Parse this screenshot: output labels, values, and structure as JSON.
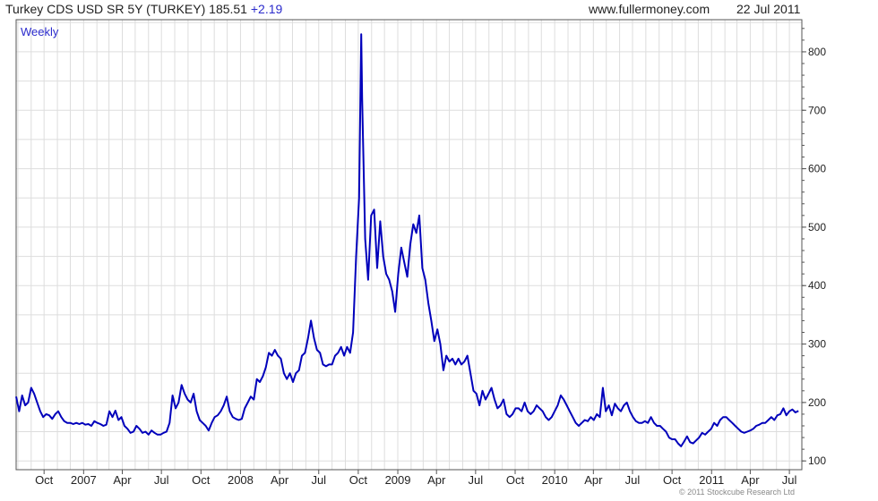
{
  "header": {
    "title": "Turkey CDS USD SR 5Y (TURKEY) 185.51",
    "change": "+2.19",
    "site": "www.fullermoney.com",
    "date": "22 Jul 2011"
  },
  "footer": {
    "copyright": "© 2011 Stockcube Research Ltd"
  },
  "colors": {
    "line": "#0000bb",
    "grid": "#dddddd",
    "frame": "#555555",
    "label": "#2b2bcc"
  },
  "chart_data": {
    "type": "line",
    "frequency_label": "Weekly",
    "x_tick_labels": [
      "Oct",
      "2007",
      "Apr",
      "Jul",
      "Oct",
      "2008",
      "Apr",
      "Jul",
      "Oct",
      "2009",
      "Apr",
      "Jul",
      "Oct",
      "2010",
      "Apr",
      "Jul",
      "Oct",
      "2011",
      "Apr",
      "Jul"
    ],
    "x_tick_dates": [
      "2006-10-01",
      "2007-01-01",
      "2007-04-01",
      "2007-07-01",
      "2007-10-01",
      "2008-01-01",
      "2008-04-01",
      "2008-07-01",
      "2008-10-01",
      "2009-01-01",
      "2009-04-01",
      "2009-07-01",
      "2009-10-01",
      "2010-01-01",
      "2010-04-01",
      "2010-07-01",
      "2010-10-01",
      "2011-01-01",
      "2011-04-01",
      "2011-07-01"
    ],
    "y_ticks": [
      100,
      200,
      300,
      400,
      500,
      600,
      700,
      800
    ],
    "ylim": [
      85,
      855
    ],
    "xlim": [
      "2006-07-28",
      "2011-07-30"
    ],
    "y_axis_position": "right",
    "grid": true,
    "series": [
      {
        "values": [
          [
            "2006-07-28",
            210
          ],
          [
            "2006-08-04",
            185
          ],
          [
            "2006-08-11",
            212
          ],
          [
            "2006-08-18",
            195
          ],
          [
            "2006-08-25",
            200
          ],
          [
            "2006-09-01",
            225
          ],
          [
            "2006-09-08",
            215
          ],
          [
            "2006-09-15",
            200
          ],
          [
            "2006-09-22",
            185
          ],
          [
            "2006-09-29",
            175
          ],
          [
            "2006-10-06",
            180
          ],
          [
            "2006-10-13",
            178
          ],
          [
            "2006-10-20",
            172
          ],
          [
            "2006-10-27",
            180
          ],
          [
            "2006-11-03",
            185
          ],
          [
            "2006-11-10",
            175
          ],
          [
            "2006-11-17",
            168
          ],
          [
            "2006-11-24",
            165
          ],
          [
            "2006-12-01",
            165
          ],
          [
            "2006-12-08",
            163
          ],
          [
            "2006-12-15",
            165
          ],
          [
            "2006-12-22",
            163
          ],
          [
            "2006-12-29",
            165
          ],
          [
            "2007-01-05",
            162
          ],
          [
            "2007-01-12",
            163
          ],
          [
            "2007-01-19",
            160
          ],
          [
            "2007-01-26",
            168
          ],
          [
            "2007-02-02",
            165
          ],
          [
            "2007-02-09",
            163
          ],
          [
            "2007-02-16",
            160
          ],
          [
            "2007-02-23",
            162
          ],
          [
            "2007-03-02",
            185
          ],
          [
            "2007-03-09",
            175
          ],
          [
            "2007-03-16",
            186
          ],
          [
            "2007-03-23",
            170
          ],
          [
            "2007-03-30",
            175
          ],
          [
            "2007-04-06",
            160
          ],
          [
            "2007-04-13",
            155
          ],
          [
            "2007-04-20",
            148
          ],
          [
            "2007-04-27",
            150
          ],
          [
            "2007-05-04",
            160
          ],
          [
            "2007-05-11",
            155
          ],
          [
            "2007-05-18",
            148
          ],
          [
            "2007-05-25",
            150
          ],
          [
            "2007-06-01",
            145
          ],
          [
            "2007-06-08",
            152
          ],
          [
            "2007-06-15",
            148
          ],
          [
            "2007-06-22",
            145
          ],
          [
            "2007-06-29",
            145
          ],
          [
            "2007-07-06",
            148
          ],
          [
            "2007-07-13",
            150
          ],
          [
            "2007-07-20",
            165
          ],
          [
            "2007-07-27",
            212
          ],
          [
            "2007-08-03",
            190
          ],
          [
            "2007-08-10",
            200
          ],
          [
            "2007-08-17",
            230
          ],
          [
            "2007-08-24",
            215
          ],
          [
            "2007-08-31",
            205
          ],
          [
            "2007-09-07",
            200
          ],
          [
            "2007-09-14",
            215
          ],
          [
            "2007-09-21",
            185
          ],
          [
            "2007-09-28",
            170
          ],
          [
            "2007-10-05",
            165
          ],
          [
            "2007-10-12",
            160
          ],
          [
            "2007-10-19",
            152
          ],
          [
            "2007-10-26",
            165
          ],
          [
            "2007-11-02",
            175
          ],
          [
            "2007-11-09",
            178
          ],
          [
            "2007-11-16",
            185
          ],
          [
            "2007-11-23",
            195
          ],
          [
            "2007-11-30",
            210
          ],
          [
            "2007-12-07",
            185
          ],
          [
            "2007-12-14",
            175
          ],
          [
            "2007-12-21",
            172
          ],
          [
            "2007-12-28",
            170
          ],
          [
            "2008-01-04",
            172
          ],
          [
            "2008-01-11",
            190
          ],
          [
            "2008-01-18",
            200
          ],
          [
            "2008-01-25",
            210
          ],
          [
            "2008-02-01",
            205
          ],
          [
            "2008-02-08",
            240
          ],
          [
            "2008-02-15",
            235
          ],
          [
            "2008-02-22",
            245
          ],
          [
            "2008-02-29",
            260
          ],
          [
            "2008-03-07",
            285
          ],
          [
            "2008-03-14",
            280
          ],
          [
            "2008-03-21",
            290
          ],
          [
            "2008-03-28",
            280
          ],
          [
            "2008-04-04",
            275
          ],
          [
            "2008-04-11",
            250
          ],
          [
            "2008-04-18",
            240
          ],
          [
            "2008-04-25",
            250
          ],
          [
            "2008-05-02",
            235
          ],
          [
            "2008-05-09",
            250
          ],
          [
            "2008-05-16",
            255
          ],
          [
            "2008-05-23",
            280
          ],
          [
            "2008-05-30",
            285
          ],
          [
            "2008-06-06",
            310
          ],
          [
            "2008-06-13",
            340
          ],
          [
            "2008-06-20",
            310
          ],
          [
            "2008-06-27",
            290
          ],
          [
            "2008-07-04",
            285
          ],
          [
            "2008-07-11",
            265
          ],
          [
            "2008-07-18",
            262
          ],
          [
            "2008-07-25",
            265
          ],
          [
            "2008-08-01",
            265
          ],
          [
            "2008-08-08",
            280
          ],
          [
            "2008-08-15",
            285
          ],
          [
            "2008-08-22",
            295
          ],
          [
            "2008-08-29",
            280
          ],
          [
            "2008-09-05",
            295
          ],
          [
            "2008-09-12",
            285
          ],
          [
            "2008-09-19",
            320
          ],
          [
            "2008-09-26",
            450
          ],
          [
            "2008-10-03",
            550
          ],
          [
            "2008-10-08",
            830
          ],
          [
            "2008-10-10",
            720
          ],
          [
            "2008-10-17",
            480
          ],
          [
            "2008-10-24",
            410
          ],
          [
            "2008-10-31",
            520
          ],
          [
            "2008-11-07",
            530
          ],
          [
            "2008-11-14",
            430
          ],
          [
            "2008-11-21",
            510
          ],
          [
            "2008-11-28",
            450
          ],
          [
            "2008-12-05",
            420
          ],
          [
            "2008-12-12",
            410
          ],
          [
            "2008-12-19",
            390
          ],
          [
            "2008-12-26",
            355
          ],
          [
            "2009-01-02",
            420
          ],
          [
            "2009-01-09",
            465
          ],
          [
            "2009-01-16",
            440
          ],
          [
            "2009-01-23",
            415
          ],
          [
            "2009-01-30",
            470
          ],
          [
            "2009-02-06",
            505
          ],
          [
            "2009-02-13",
            490
          ],
          [
            "2009-02-20",
            520
          ],
          [
            "2009-02-27",
            430
          ],
          [
            "2009-03-06",
            410
          ],
          [
            "2009-03-13",
            370
          ],
          [
            "2009-03-20",
            340
          ],
          [
            "2009-03-27",
            305
          ],
          [
            "2009-04-03",
            325
          ],
          [
            "2009-04-10",
            300
          ],
          [
            "2009-04-17",
            255
          ],
          [
            "2009-04-24",
            280
          ],
          [
            "2009-05-01",
            270
          ],
          [
            "2009-05-08",
            275
          ],
          [
            "2009-05-15",
            265
          ],
          [
            "2009-05-22",
            275
          ],
          [
            "2009-05-29",
            265
          ],
          [
            "2009-06-05",
            270
          ],
          [
            "2009-06-12",
            280
          ],
          [
            "2009-06-19",
            250
          ],
          [
            "2009-06-26",
            220
          ],
          [
            "2009-07-03",
            215
          ],
          [
            "2009-07-10",
            195
          ],
          [
            "2009-07-17",
            220
          ],
          [
            "2009-07-24",
            205
          ],
          [
            "2009-07-31",
            215
          ],
          [
            "2009-08-07",
            225
          ],
          [
            "2009-08-14",
            205
          ],
          [
            "2009-08-21",
            190
          ],
          [
            "2009-08-28",
            195
          ],
          [
            "2009-09-04",
            205
          ],
          [
            "2009-09-11",
            180
          ],
          [
            "2009-09-18",
            175
          ],
          [
            "2009-09-25",
            180
          ],
          [
            "2009-10-02",
            190
          ],
          [
            "2009-10-09",
            190
          ],
          [
            "2009-10-16",
            185
          ],
          [
            "2009-10-23",
            200
          ],
          [
            "2009-10-30",
            185
          ],
          [
            "2009-11-06",
            180
          ],
          [
            "2009-11-13",
            185
          ],
          [
            "2009-11-20",
            195
          ],
          [
            "2009-11-27",
            190
          ],
          [
            "2009-12-04",
            185
          ],
          [
            "2009-12-11",
            175
          ],
          [
            "2009-12-18",
            170
          ],
          [
            "2009-12-25",
            175
          ],
          [
            "2010-01-01",
            185
          ],
          [
            "2010-01-08",
            195
          ],
          [
            "2010-01-15",
            212
          ],
          [
            "2010-01-22",
            205
          ],
          [
            "2010-01-29",
            195
          ],
          [
            "2010-02-05",
            185
          ],
          [
            "2010-02-12",
            175
          ],
          [
            "2010-02-19",
            165
          ],
          [
            "2010-02-26",
            160
          ],
          [
            "2010-03-05",
            165
          ],
          [
            "2010-03-12",
            170
          ],
          [
            "2010-03-19",
            168
          ],
          [
            "2010-03-26",
            175
          ],
          [
            "2010-04-02",
            170
          ],
          [
            "2010-04-09",
            180
          ],
          [
            "2010-04-16",
            175
          ],
          [
            "2010-04-23",
            225
          ],
          [
            "2010-04-30",
            185
          ],
          [
            "2010-05-07",
            195
          ],
          [
            "2010-05-14",
            178
          ],
          [
            "2010-05-21",
            198
          ],
          [
            "2010-05-28",
            190
          ],
          [
            "2010-06-04",
            185
          ],
          [
            "2010-06-11",
            195
          ],
          [
            "2010-06-18",
            200
          ],
          [
            "2010-06-25",
            185
          ],
          [
            "2010-07-02",
            175
          ],
          [
            "2010-07-09",
            168
          ],
          [
            "2010-07-16",
            165
          ],
          [
            "2010-07-23",
            165
          ],
          [
            "2010-07-30",
            168
          ],
          [
            "2010-08-06",
            165
          ],
          [
            "2010-08-13",
            175
          ],
          [
            "2010-08-20",
            165
          ],
          [
            "2010-08-27",
            160
          ],
          [
            "2010-09-03",
            160
          ],
          [
            "2010-09-10",
            155
          ],
          [
            "2010-09-17",
            150
          ],
          [
            "2010-09-24",
            140
          ],
          [
            "2010-10-01",
            137
          ],
          [
            "2010-10-08",
            137
          ],
          [
            "2010-10-15",
            130
          ],
          [
            "2010-10-22",
            125
          ],
          [
            "2010-10-29",
            133
          ],
          [
            "2010-11-05",
            142
          ],
          [
            "2010-11-12",
            132
          ],
          [
            "2010-11-19",
            130
          ],
          [
            "2010-11-26",
            135
          ],
          [
            "2010-12-03",
            140
          ],
          [
            "2010-12-10",
            148
          ],
          [
            "2010-12-17",
            145
          ],
          [
            "2010-12-24",
            150
          ],
          [
            "2010-12-31",
            155
          ],
          [
            "2011-01-07",
            165
          ],
          [
            "2011-01-14",
            160
          ],
          [
            "2011-01-21",
            170
          ],
          [
            "2011-01-28",
            175
          ],
          [
            "2011-02-04",
            175
          ],
          [
            "2011-02-11",
            170
          ],
          [
            "2011-02-18",
            165
          ],
          [
            "2011-02-25",
            160
          ],
          [
            "2011-03-04",
            155
          ],
          [
            "2011-03-11",
            150
          ],
          [
            "2011-03-18",
            148
          ],
          [
            "2011-03-25",
            150
          ],
          [
            "2011-04-01",
            152
          ],
          [
            "2011-04-08",
            155
          ],
          [
            "2011-04-15",
            160
          ],
          [
            "2011-04-22",
            162
          ],
          [
            "2011-04-29",
            165
          ],
          [
            "2011-05-06",
            165
          ],
          [
            "2011-05-13",
            170
          ],
          [
            "2011-05-20",
            175
          ],
          [
            "2011-05-27",
            170
          ],
          [
            "2011-06-03",
            178
          ],
          [
            "2011-06-10",
            180
          ],
          [
            "2011-06-17",
            190
          ],
          [
            "2011-06-24",
            178
          ],
          [
            "2011-07-01",
            185
          ],
          [
            "2011-07-08",
            188
          ],
          [
            "2011-07-15",
            183
          ],
          [
            "2011-07-22",
            185.51
          ]
        ]
      }
    ]
  }
}
